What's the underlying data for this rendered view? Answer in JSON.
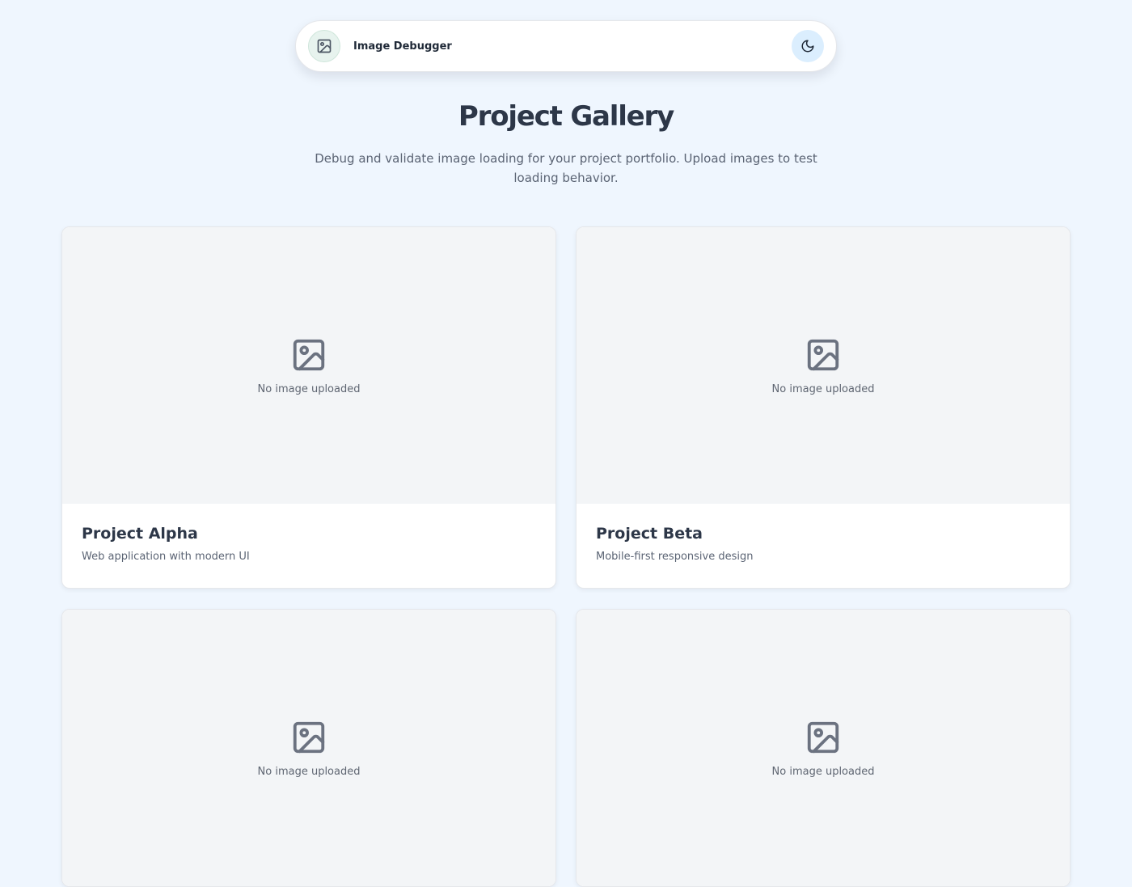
{
  "header": {
    "app_title": "Image Debugger",
    "logo_icon": "image-icon",
    "theme_toggle_icon": "moon-icon"
  },
  "main": {
    "title": "Project Gallery",
    "subtitle": "Debug and validate image loading for your project portfolio. Upload images to test loading behavior."
  },
  "projects": [
    {
      "title": "Project Alpha",
      "description": "Web application with modern UI",
      "placeholder": "No image uploaded",
      "icon": "image-icon"
    },
    {
      "title": "Project Beta",
      "description": "Mobile-first responsive design",
      "placeholder": "No image uploaded",
      "icon": "image-icon"
    },
    {
      "placeholder": "No image uploaded",
      "icon": "image-icon"
    },
    {
      "placeholder": "No image uploaded",
      "icon": "image-icon"
    }
  ],
  "colors": {
    "page_background": "#eff6fe",
    "card_media_background": "#f3f5f7",
    "icon_gray": "#6b7280",
    "heading": "#2d3748",
    "theme_toggle_background": "#dbeefe",
    "logo_badge_background": "#e7f3ee"
  }
}
